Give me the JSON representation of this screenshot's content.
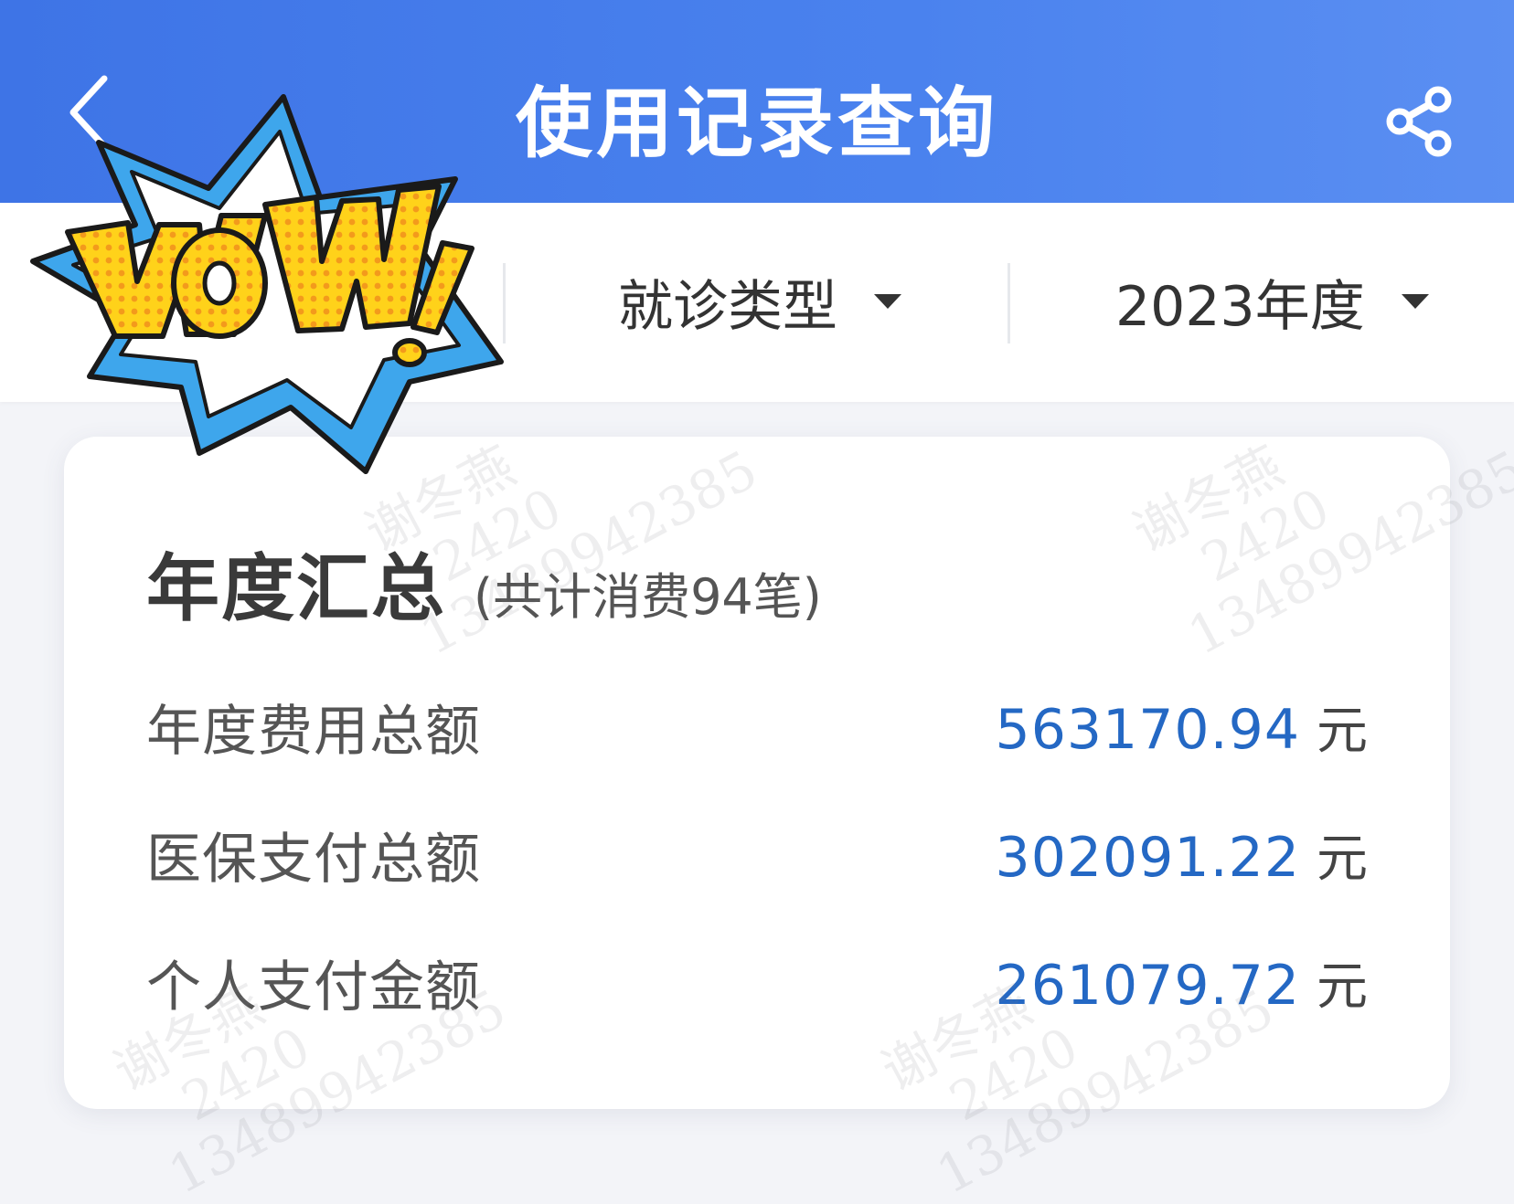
{
  "header": {
    "title": "使用记录查询",
    "back_icon": "chevron-left-icon",
    "share_icon": "share-icon"
  },
  "filters": {
    "visit_type": "就诊类型",
    "year": "2023年度"
  },
  "summary": {
    "title": "年度汇总",
    "subtitle": "(共计消费94笔)",
    "rows": [
      {
        "label": "年度费用总额",
        "value": "563170.94",
        "unit": "元"
      },
      {
        "label": "医保支付总额",
        "value": "302091.22",
        "unit": "元"
      },
      {
        "label": "个人支付金额",
        "value": "261079.72",
        "unit": "元"
      }
    ]
  },
  "watermark": {
    "name": "谢冬燕",
    "code": "2420",
    "phone": "13489942385"
  },
  "sticker": {
    "text": "WoW!"
  },
  "colors": {
    "header_blue": "#4a82ee",
    "value_blue": "#2468c4",
    "background": "#f3f4f8"
  }
}
